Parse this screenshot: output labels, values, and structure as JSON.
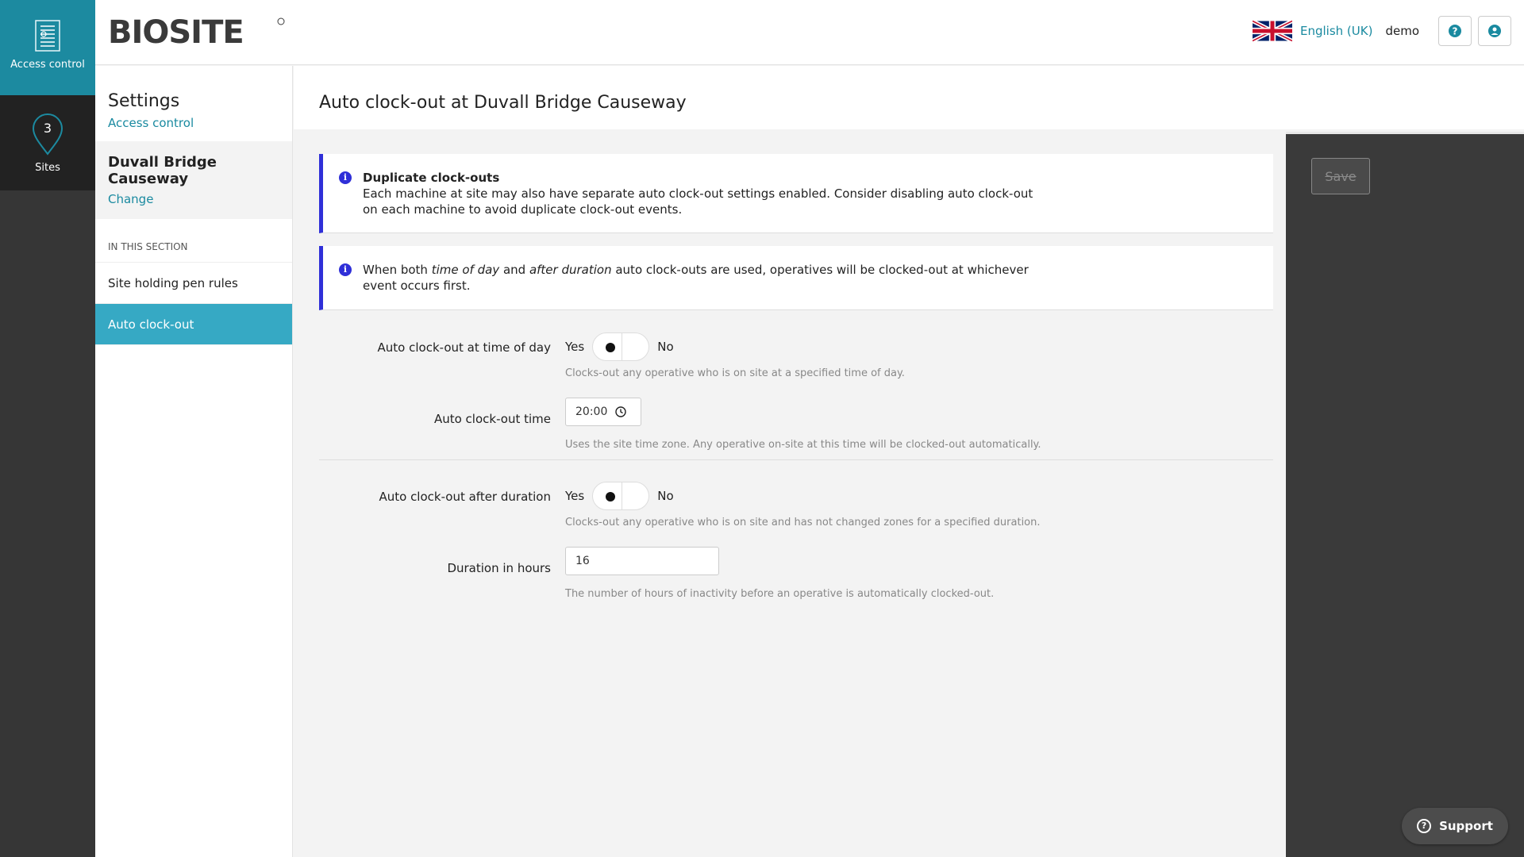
{
  "rail": {
    "access_control": "Access control",
    "sites": "Sites",
    "sites_count": "3"
  },
  "header": {
    "logo": "BIOSITE",
    "language": "English (UK)",
    "user": "demo"
  },
  "sidebar": {
    "title": "Settings",
    "subtitle_link": "Access control",
    "site_name": "Duvall Bridge Causeway",
    "change_link": "Change",
    "section_label": "IN THIS SECTION",
    "items": [
      {
        "label": "Site holding pen rules"
      },
      {
        "label": "Auto clock-out"
      }
    ]
  },
  "page": {
    "title": "Auto clock-out at Duvall Bridge Causeway"
  },
  "alerts": {
    "dup_title": "Duplicate clock-outs",
    "dup_body": "Each machine at site may also have separate auto clock-out settings enabled. Consider disabling auto clock-out on each machine to avoid duplicate clock-out events.",
    "both_pre": "When both ",
    "both_em1": "time of day",
    "both_mid": " and ",
    "both_em2": "after duration",
    "both_post": " auto clock-outs are used, operatives will be clocked-out at whichever event occurs first."
  },
  "form": {
    "yes": "Yes",
    "no": "No",
    "time_of_day_label": "Auto clock-out at time of day",
    "time_of_day_help": "Clocks-out any operative who is on site at a specified time of day.",
    "time_label": "Auto clock-out time",
    "time_value": "20:00",
    "time_help": "Uses the site time zone. Any operative on-site at this time will be clocked-out automatically.",
    "duration_toggle_label": "Auto clock-out after duration",
    "duration_toggle_help": "Clocks-out any operative who is on site and has not changed zones for a specified duration.",
    "duration_label": "Duration in hours",
    "duration_value": "16",
    "duration_help": "The number of hours of inactivity before an operative is automatically clocked-out."
  },
  "actions": {
    "save": "Save",
    "support": "Support"
  },
  "colors": {
    "accent": "#1a8aa0",
    "active_item": "#36a9c4",
    "alert_border": "#2f2fd8"
  }
}
